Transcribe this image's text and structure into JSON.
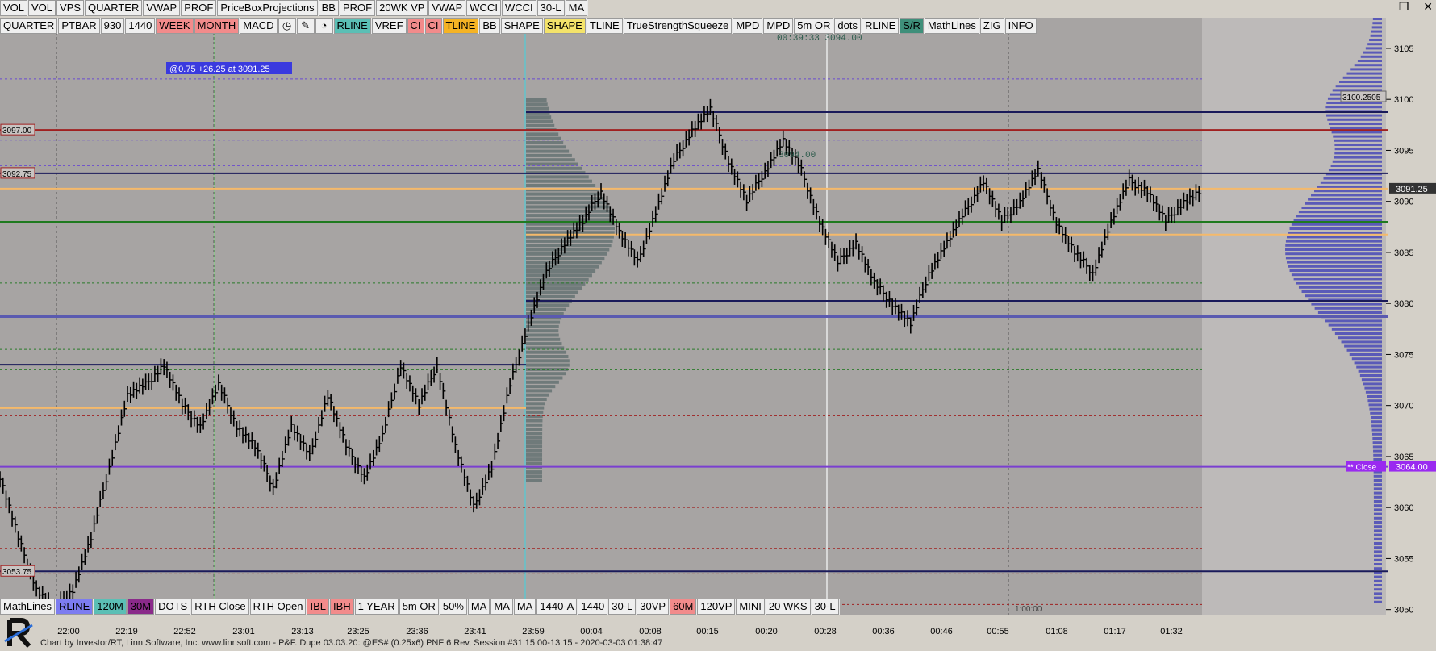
{
  "window": {
    "restore_label": "❐",
    "close_label": "✕"
  },
  "toolbar_top": [
    {
      "label": "VOL",
      "style": ""
    },
    {
      "label": "VOL",
      "style": ""
    },
    {
      "label": "VPS",
      "style": ""
    },
    {
      "label": "QUARTER",
      "style": ""
    },
    {
      "label": "VWAP",
      "style": ""
    },
    {
      "label": "PROF",
      "style": ""
    },
    {
      "label": "PriceBoxProjections",
      "style": ""
    },
    {
      "label": "BB",
      "style": ""
    },
    {
      "label": "PROF",
      "style": ""
    },
    {
      "label": "20WK VP",
      "style": ""
    },
    {
      "label": "VWAP",
      "style": ""
    },
    {
      "label": "WCCI",
      "style": ""
    },
    {
      "label": "WCCI",
      "style": ""
    },
    {
      "label": "30-L",
      "style": ""
    },
    {
      "label": "MA",
      "style": ""
    }
  ],
  "toolbar_second": [
    {
      "label": "QUARTER",
      "style": ""
    },
    {
      "label": "PTBAR",
      "style": ""
    },
    {
      "label": "930",
      "style": ""
    },
    {
      "label": "1440",
      "style": ""
    },
    {
      "label": "WEEK",
      "style": "pink"
    },
    {
      "label": "MONTH",
      "style": "pink"
    },
    {
      "label": "MACD",
      "style": ""
    },
    {
      "label": "◷",
      "style": "icon",
      "name": "clock-icon"
    },
    {
      "label": "✎",
      "style": "icon",
      "name": "pencil-icon"
    },
    {
      "label": "◔",
      "style": "icon",
      "name": "timer-icon"
    },
    {
      "label": "RLINE",
      "style": "teal"
    },
    {
      "label": "VREF",
      "style": ""
    },
    {
      "label": "CI",
      "style": "pink"
    },
    {
      "label": "CI",
      "style": "pink"
    },
    {
      "label": "TLINE",
      "style": "gold"
    },
    {
      "label": "BB",
      "style": ""
    },
    {
      "label": "SHAPE",
      "style": ""
    },
    {
      "label": "SHAPE",
      "style": "yellow"
    },
    {
      "label": "TLINE",
      "style": ""
    },
    {
      "label": "TrueStrengthSqueeze",
      "style": ""
    },
    {
      "label": "MPD",
      "style": ""
    },
    {
      "label": "MPD",
      "style": ""
    },
    {
      "label": "5m OR",
      "style": ""
    },
    {
      "label": "dots",
      "style": ""
    },
    {
      "label": "RLINE",
      "style": ""
    },
    {
      "label": "S/R",
      "style": "dteal"
    },
    {
      "label": "MathLines",
      "style": ""
    },
    {
      "label": "ZIG",
      "style": ""
    },
    {
      "label": "INFO",
      "style": ""
    }
  ],
  "toolbar_bottom": [
    {
      "label": "MathLines",
      "style": ""
    },
    {
      "label": "RLINE",
      "style": "blue"
    },
    {
      "label": "120M",
      "style": "teal"
    },
    {
      "label": "30M",
      "style": "purple"
    },
    {
      "label": "DOTS",
      "style": ""
    },
    {
      "label": "RTH Close",
      "style": ""
    },
    {
      "label": "RTH Open",
      "style": ""
    },
    {
      "label": "IBL",
      "style": "pink"
    },
    {
      "label": "IBH",
      "style": "pink"
    },
    {
      "label": "1 YEAR",
      "style": ""
    },
    {
      "label": "5m OR",
      "style": ""
    },
    {
      "label": "50%",
      "style": ""
    },
    {
      "label": "MA",
      "style": ""
    },
    {
      "label": "MA",
      "style": ""
    },
    {
      "label": "MA",
      "style": ""
    },
    {
      "label": "1440-A",
      "style": ""
    },
    {
      "label": "1440",
      "style": ""
    },
    {
      "label": "30-L",
      "style": ""
    },
    {
      "label": "30VP",
      "style": ""
    },
    {
      "label": "60M",
      "style": "pink"
    },
    {
      "label": "120VP",
      "style": ""
    },
    {
      "label": "MINI",
      "style": ""
    },
    {
      "label": "20 WKS",
      "style": ""
    },
    {
      "label": "30-L",
      "style": ""
    }
  ],
  "chart": {
    "annotation_box": "@0.75  +26.25 at 3091.25",
    "timer_text": "00:39:33",
    "timer_price": "3094.00",
    "mid_price_label": "3094.00",
    "left_labels": [
      "3097.00",
      "3092.75",
      "3053.75"
    ],
    "right_labels": {
      "top": "3100.2505",
      "last": "3091.25",
      "close_tag": "** Close",
      "close_price": "3064.00"
    },
    "bottom_marker": "1:00:00",
    "status_bar": "Chart by Investor/RT, Linn Software, Inc. www.linnsoft.com - P&F. Dupe 03.03.20: @ES# (0.25x6) PNF 6 Rev, Session #31 15:00-13:15 - 2020-03-03 01:38:47",
    "colors": {
      "plot_bg": "#a7a4a3",
      "right_bg": "#bdbab9",
      "axis_bg": "#d4d0c8",
      "bar": "#000000",
      "poc_orange": "#f5b96a",
      "green": "#1f7a1f",
      "navy": "#1a1a5a",
      "red": "#a02020",
      "purple_line": "#7a3fd0",
      "blue_band": "#5a5ab0"
    }
  },
  "chart_data": {
    "type": "line",
    "title": "",
    "xlabel": "",
    "ylabel": "",
    "ylim": [
      3049.5,
      3108
    ],
    "x": [
      "22:00",
      "22:19",
      "22:52",
      "23:01",
      "23:13",
      "23:25",
      "23:36",
      "23:41",
      "23:59",
      "00:04",
      "00:08",
      "00:15",
      "00:20",
      "00:28",
      "00:36",
      "00:46",
      "00:55",
      "01:08",
      "01:17",
      "01:32"
    ],
    "price_path": [
      3063,
      3057,
      3052,
      3050,
      3052,
      3057,
      3064,
      3071,
      3072,
      3074,
      3070,
      3068,
      3072,
      3068,
      3066,
      3062,
      3068,
      3065,
      3071,
      3066,
      3063,
      3067,
      3074,
      3070,
      3074,
      3066,
      3060,
      3064,
      3072,
      3078,
      3083,
      3086,
      3088,
      3091,
      3087,
      3084,
      3089,
      3094,
      3097,
      3099,
      3094,
      3090,
      3093,
      3096,
      3093,
      3088,
      3084,
      3086,
      3082,
      3080,
      3078,
      3083,
      3086,
      3089,
      3092,
      3088,
      3090,
      3093,
      3088,
      3085,
      3083,
      3088,
      3092,
      3091,
      3088,
      3090,
      3091
    ],
    "horizontal_levels": [
      {
        "price": 3097.0,
        "label": "3097.00",
        "color": "red"
      },
      {
        "price": 3092.75,
        "label": "3092.75",
        "color": "navy"
      },
      {
        "price": 3091.25,
        "label": "3091.25",
        "color": "orange"
      },
      {
        "price": 3088.0,
        "label": "",
        "color": "green"
      },
      {
        "price": 3078.75,
        "label": "",
        "color": "blue"
      },
      {
        "price": 3064.0,
        "label": "3064.00",
        "color": "purple"
      },
      {
        "price": 3053.75,
        "label": "3053.75",
        "color": "navy"
      }
    ],
    "yticks": [
      3050,
      3055,
      3060,
      3065,
      3070,
      3075,
      3080,
      3085,
      3090,
      3095,
      3100,
      3105
    ]
  }
}
